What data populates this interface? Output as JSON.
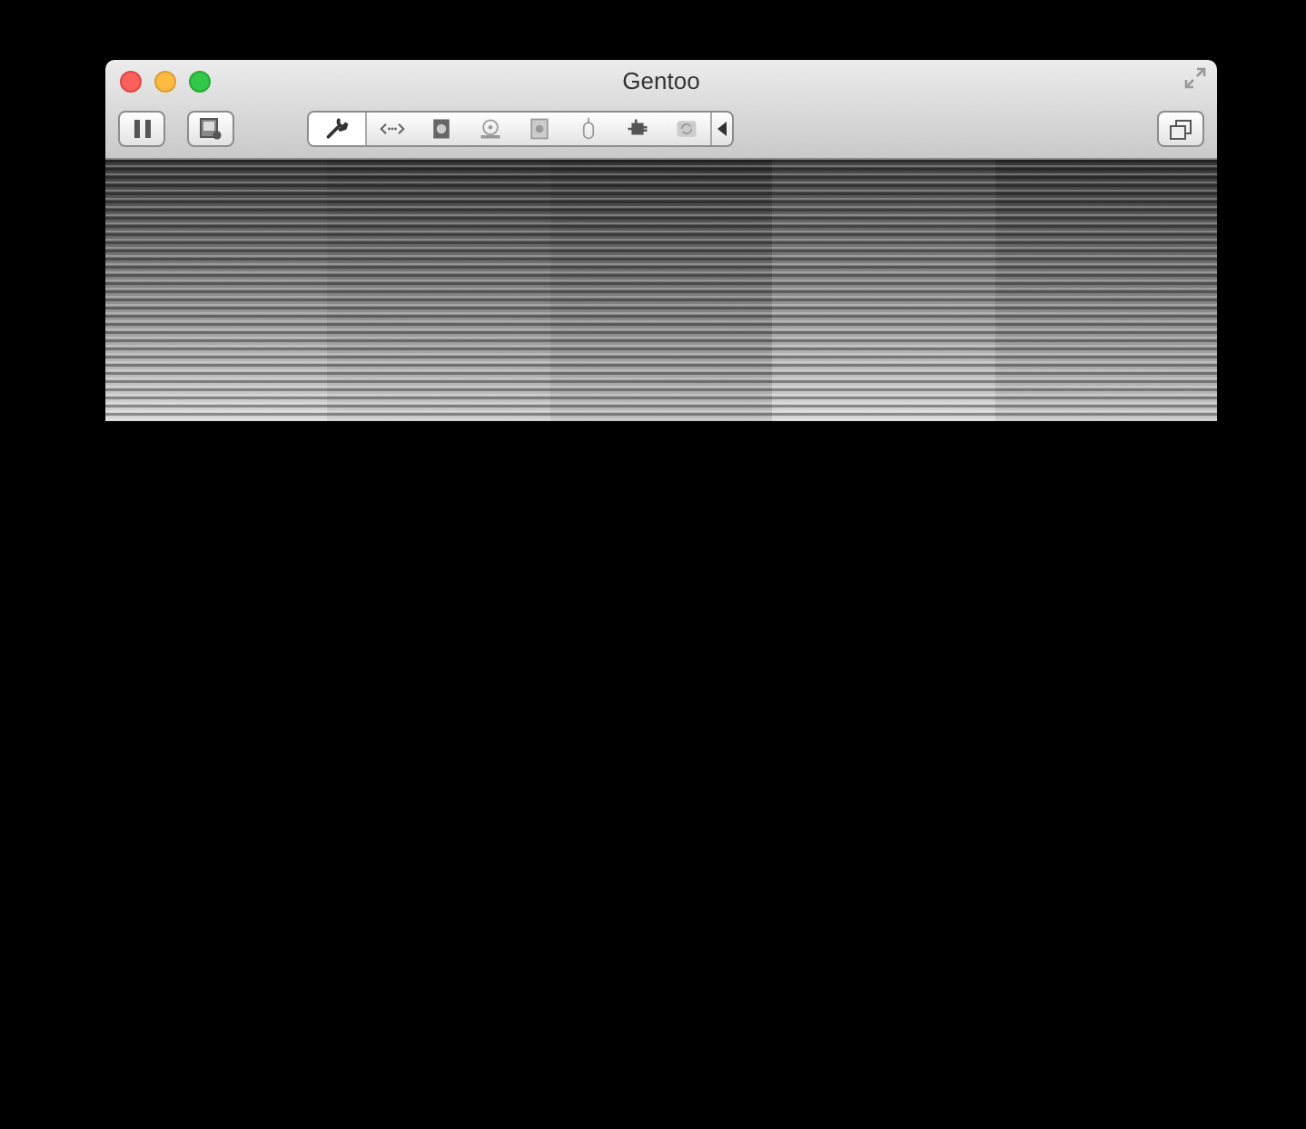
{
  "window": {
    "title": "Gentoo"
  },
  "toolbar": {
    "devices": [
      {
        "kind": "settings",
        "selected": true
      },
      {
        "kind": "network",
        "selected": false
      },
      {
        "kind": "disk",
        "selected": false
      },
      {
        "kind": "optical",
        "selected": false
      },
      {
        "kind": "floppy",
        "selected": false
      },
      {
        "kind": "mouse",
        "selected": false
      },
      {
        "kind": "usb",
        "selected": false
      },
      {
        "kind": "sync",
        "selected": false
      }
    ]
  }
}
